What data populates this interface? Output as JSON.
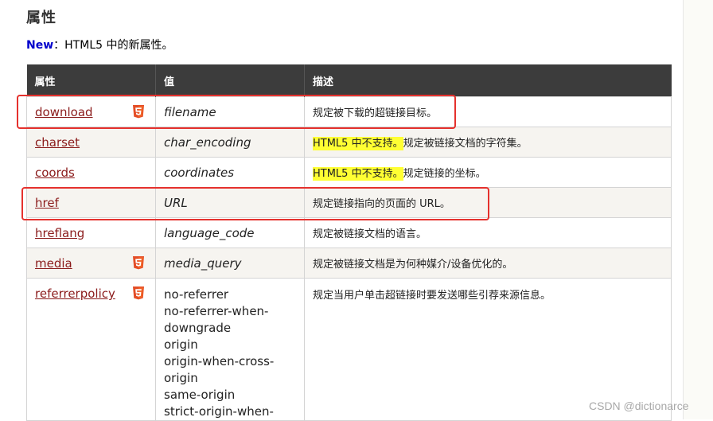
{
  "section_title": "属性",
  "new_note": {
    "tag": "New",
    "text": "：HTML5 中的新属性。"
  },
  "table": {
    "headers": [
      "属性",
      "值",
      "描述"
    ],
    "rows": [
      {
        "attr": "download",
        "html5": true,
        "value": "filename",
        "desc_highlight": "",
        "desc": "规定被下载的超链接目标。"
      },
      {
        "attr": "charset",
        "html5": false,
        "value": "char_encoding",
        "desc_highlight": "HTML5 中不支持。",
        "desc": "规定被链接文档的字符集。"
      },
      {
        "attr": "coords",
        "html5": false,
        "value": "coordinates",
        "desc_highlight": "HTML5 中不支持。",
        "desc": "规定链接的坐标。"
      },
      {
        "attr": "href",
        "html5": false,
        "value": "URL",
        "desc_highlight": "",
        "desc": "规定链接指向的页面的 URL。"
      },
      {
        "attr": "hreflang",
        "html5": false,
        "value": "language_code",
        "desc_highlight": "",
        "desc": "规定被链接文档的语言。"
      },
      {
        "attr": "media",
        "html5": true,
        "value": "media_query",
        "desc_highlight": "",
        "desc": "规定被链接文档是为何种媒介/设备优化的。"
      },
      {
        "attr": "referrerpolicy",
        "html5": true,
        "desc_highlight": "",
        "desc": "规定当用户单击超链接时要发送哪些引荐来源信息。",
        "value_lines": [
          "no-referrer",
          "no-referrer-when-",
          "downgrade",
          "origin",
          "origin-when-cross-",
          "origin",
          "same-origin",
          "strict-origin-when-"
        ]
      }
    ]
  },
  "watermark": "CSDN @dictionarce",
  "colors": {
    "header_bg": "#3c3c3c",
    "link": "#8b1b1b",
    "highlight": "#ffff33",
    "new_tag": "#0000cc",
    "annotation": "#e5312d",
    "html5_badge": "#e44d26"
  },
  "icons": {
    "html5_badge": "html5-icon"
  }
}
